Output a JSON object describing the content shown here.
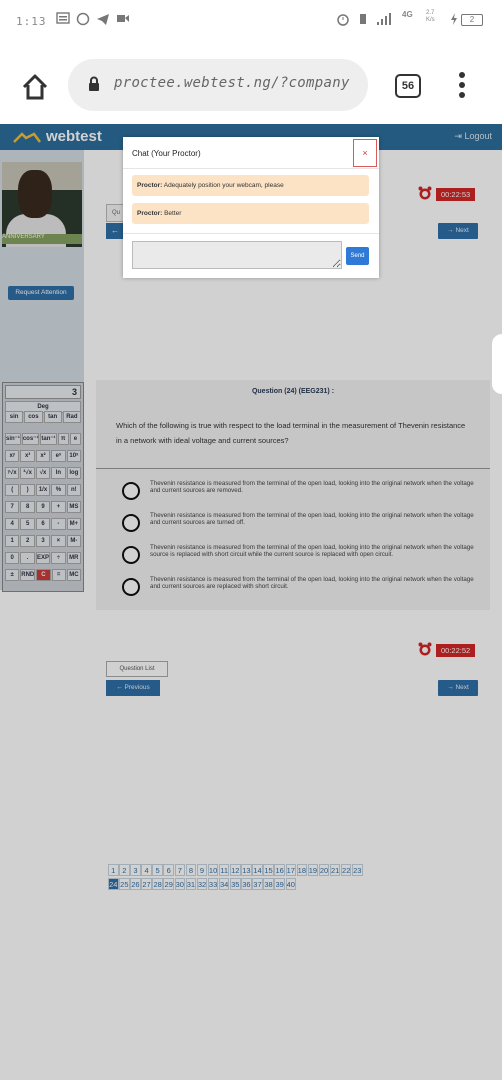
{
  "status_bar": {
    "time": "1:13",
    "network": "4G",
    "data_speed": "2.7 K/s",
    "battery": "2"
  },
  "browser": {
    "url": "proctee.webtest.ng/?company",
    "tab_count": "56"
  },
  "site": {
    "brand": "webtest",
    "logout_label": "Logout"
  },
  "left_panel": {
    "request_attention_label": "Request Attention",
    "webcam_strip_text": "ANNIVERSARY"
  },
  "calculator": {
    "display": "3",
    "rows": [
      [
        "Deg"
      ],
      [
        "sin",
        "cos",
        "tan",
        "Rad"
      ],
      [
        "sin⁻¹",
        "cos⁻¹",
        "tan⁻¹",
        "π",
        "e"
      ],
      [
        "xʸ",
        "x³",
        "x²",
        "eˣ",
        "10ˣ"
      ],
      [
        "ʸ√x",
        "³√x",
        "√x",
        "ln",
        "log"
      ],
      [
        "(",
        ")",
        "1/x",
        "%",
        "n!"
      ],
      [
        "7",
        "8",
        "9",
        "+",
        "MS"
      ],
      [
        "4",
        "5",
        "6",
        "-",
        "M+"
      ],
      [
        "1",
        "2",
        "3",
        "×",
        "M-"
      ],
      [
        "0",
        ".",
        "EXP",
        "÷",
        "MR"
      ],
      [
        "±",
        "RND",
        "C",
        "=",
        "MC"
      ]
    ]
  },
  "question": {
    "title": "Question (24) (EEG231) :",
    "text": "Which of the following is true with respect to the load terminal in the measurement of Thevenin resistance in a network with ideal voltage and current sources?",
    "options": [
      "Thevenin resistance is measured from the terminal of the open load, looking into the original network when the voltage and current sources are removed.",
      "Thevenin resistance is measured from the terminal of the open load, looking into the original network when the voltage and current sources are turned off.",
      "Thevenin resistance is measured from the terminal of the open load, looking into the original network when the voltage source is replaced with short circuit while the current source is replaced with open circuit.",
      "Thevenin resistance is measured from the terminal of the open load, looking into the original network when the voltage and current sources are replaced with short circuit."
    ]
  },
  "timers": {
    "top": "00:22:53",
    "bottom": "00:22:52"
  },
  "nav": {
    "next_label": "→ Next",
    "previous_label": "← Previous",
    "question_list_label": "Question List",
    "top_box_label": "Qu"
  },
  "pager": {
    "row1": [
      "1",
      "2",
      "3",
      "4",
      "5",
      "6",
      "7",
      "8",
      "9",
      "10",
      "11",
      "12",
      "13",
      "14",
      "15",
      "16",
      "17",
      "18",
      "19",
      "20",
      "21",
      "22",
      "23"
    ],
    "row2": [
      "24",
      "25",
      "26",
      "27",
      "28",
      "29",
      "30",
      "31",
      "32",
      "33",
      "34",
      "35",
      "36",
      "37",
      "38",
      "39",
      "40"
    ],
    "active": "24"
  },
  "chat": {
    "title": "Chat (Your Proctor)",
    "close_label": "×",
    "messages": [
      {
        "sender": "Proctor:",
        "text": "Adequately position your webcam, please"
      },
      {
        "sender": "Proctor:",
        "text": "Better"
      }
    ],
    "input_value": "",
    "send_label": "Send"
  },
  "colors": {
    "accent": "#2f6fa8",
    "timer": "#d32626",
    "message_bg": "#fde3c6",
    "nav_bar": "#2c6e9b"
  }
}
